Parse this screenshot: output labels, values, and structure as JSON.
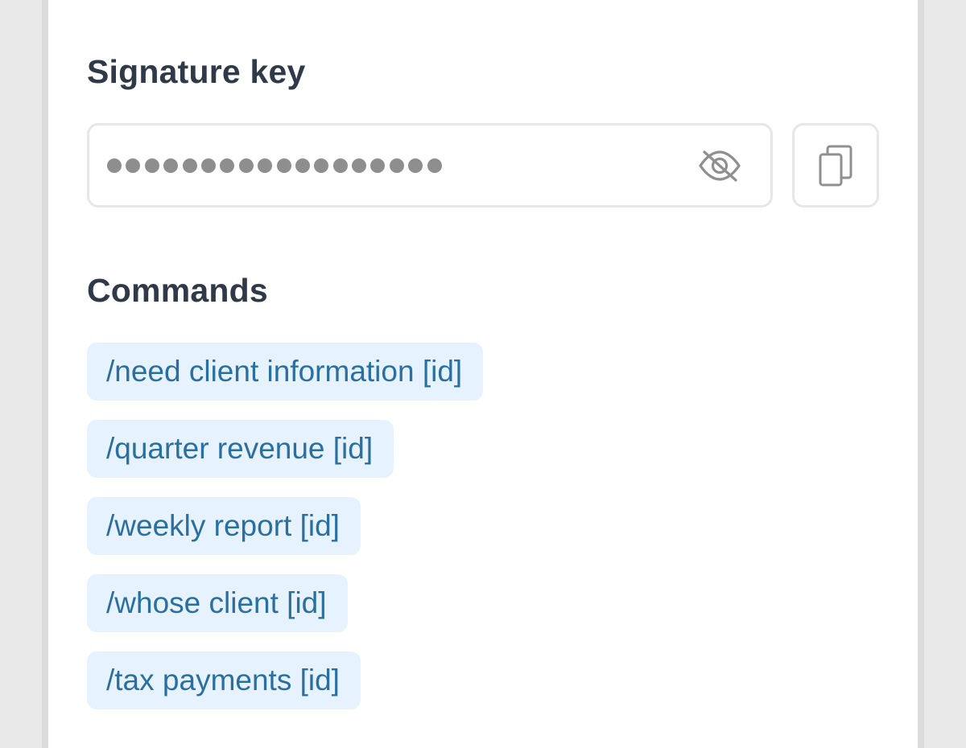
{
  "signature": {
    "title": "Signature key",
    "masked_dot_count": 18,
    "visibility_icon": "eye-slash-icon",
    "copy_icon": "copy-icon"
  },
  "commands": {
    "title": "Commands",
    "items": [
      "/need client information [id]",
      "/quarter revenue [id]",
      "/weekly report [id]",
      "/whose client [id]",
      "/tax payments [id]"
    ]
  },
  "colors": {
    "heading": "#2f3a48",
    "chip_bg": "#e6f2fe",
    "chip_text": "#2a6fa0",
    "border": "#e7e7e7",
    "mask_dots": "#8e8e8e"
  }
}
